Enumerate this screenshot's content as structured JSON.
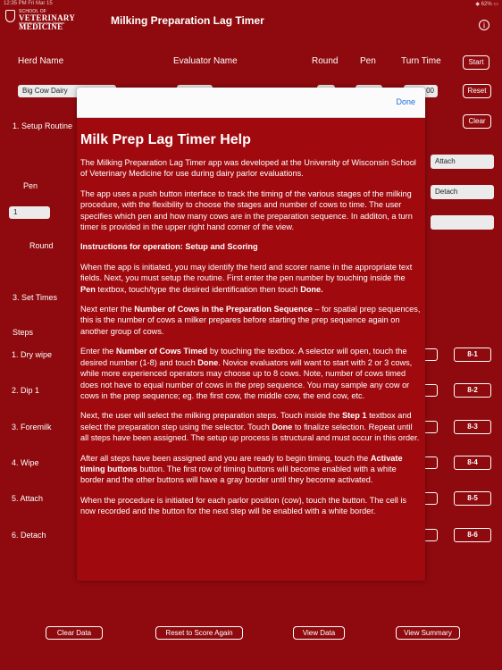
{
  "status": {
    "left": "12:35 PM  Fri Mar 15",
    "right": "◆ 62% ▭"
  },
  "logo": {
    "small": "SCHOOL OF",
    "big": "VETERINARY MEDICINE",
    "sub": "University of Wisconsin–Madison"
  },
  "app_title": "Milking Preparation Lag Timer",
  "info_icon": "i",
  "headers": {
    "herd": "Herd Name",
    "evaluator": "Evaluator Name",
    "round": "Round",
    "pen": "Pen",
    "turn_time": "Turn Time"
  },
  "buttons": {
    "start": "Start",
    "reset": "Reset",
    "clear": "Clear"
  },
  "fields": {
    "herd_value": "Big Cow Dairy",
    "turn_value": "00",
    "pen_value": "1",
    "attach_value": "Attach",
    "detach_value": "Detach"
  },
  "sections": {
    "setup_routine": "1. Setup Routine",
    "pen": "Pen",
    "round": "Round",
    "set_times": "3. Set Times",
    "steps": "Steps"
  },
  "steps": [
    {
      "label": "1. Dry wipe",
      "button": "8-1"
    },
    {
      "label": "2. Dip 1",
      "button": "8-2"
    },
    {
      "label": "3. Foremilk",
      "button": "8-3"
    },
    {
      "label": "4. Wipe",
      "button": "8-4"
    },
    {
      "label": "5. Attach",
      "button": "8-5"
    },
    {
      "label": "6. Detach",
      "button": "8-6"
    }
  ],
  "bottom_buttons": {
    "clear_data": "Clear Data",
    "reset_score": "Reset to Score Again",
    "view_data": "View Data",
    "view_summary": "View Summary"
  },
  "modal": {
    "done": "Done",
    "title": "Milk Prep Lag Timer Help",
    "p1": "The Milking Preparation Lag Timer app was developed at the University of Wisconsin School of Veterinary Medicine for use during dairy parlor evaluations.",
    "p2": "The app uses a push button interface to track the timing of the various stages of the milking procedure, with the flexibility to choose the stages and number of cows to time. The user specifies which pen and how many cows are in the preparation sequence. In additon, a turn timer is provided in the upper right hand corner of the view.",
    "p3_heading": "Instructions for operation: Setup and Scoring",
    "p4_a": "When the app is initiated, you may identify the herd and scorer name in the appropriate text fields. Next, you must setup the routine. First enter the pen number by touching inside the ",
    "p4_b": "Pen",
    "p4_c": " textbox, touch/type the desired identification then touch ",
    "p4_d": "Done.",
    "p5_a": "Next enter the ",
    "p5_b": "Number of Cows in the Preparation Sequence",
    "p5_c": " – for spatial prep sequences, this is the number of cows a milker prepares before starting the prep sequence again on another group of cows.",
    "p6_a": "Enter the ",
    "p6_b": "Number of Cows Timed",
    "p6_c": " by touching the textbox. A selector will open, touch the desired number (1-8) and touch ",
    "p6_d": "Done",
    "p6_e": ". Novice evaluators will want to start with 2 or 3 cows, while more experienced operators may choose up to 8 cows. Note, number of cows timed does not have to equal number of cows in the prep sequence. You may sample any cow or cows in the prep sequence; eg. the first cow, the middle cow, the end cow, etc.",
    "p7_a": "Next, the user will select the milking preparation steps. Touch inside the ",
    "p7_b": "Step 1",
    "p7_c": " textbox and select the preparation step using the selector. Touch ",
    "p7_d": "Done",
    "p7_e": " to finalize selection. Repeat until all steps have been assigned. The setup up process is structural and must occur in this order.",
    "p8_a": "After all steps have been assigned and you are ready to begin timing, touch the ",
    "p8_b": "Activate timing buttons",
    "p8_c": " button. The first row of timing buttons will become enabled with a white border and the other buttons will have a gray border until they become activated.",
    "p9": "When the procedure is initiated for each parlor position (cow), touch the button. The cell is now recorded and the button for the next step will be enabled with a white border."
  }
}
